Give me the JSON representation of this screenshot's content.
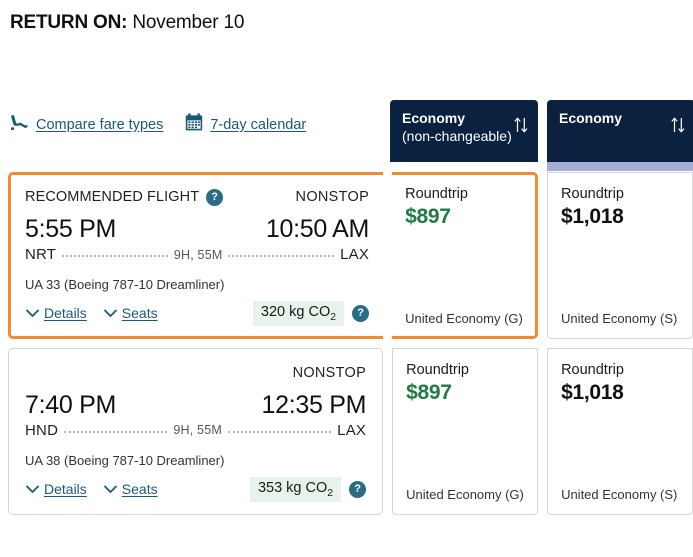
{
  "header": {
    "return_label": "RETURN ON:",
    "return_date": "November 10"
  },
  "toolbar": {
    "links": [
      {
        "icon": "seat-icon",
        "label": "Compare fare types"
      },
      {
        "icon": "calendar-icon",
        "label": "7-day calendar"
      }
    ]
  },
  "colors": {
    "header_navy": "#0a2240",
    "selected_orange": "#f08B33",
    "accent_lavender": "#a7aed4",
    "link_teal": "#1a5a73",
    "price_green": "#1e7b41",
    "co2_green_bg": "#e6f2ea",
    "help_badge": "#2b6c85"
  },
  "fare_columns": [
    {
      "title": "Economy",
      "subtitle": "(non-changeable)",
      "sort_icon": "sort-arrows-icon",
      "accent": "none"
    },
    {
      "title": "Economy",
      "subtitle": "",
      "sort_icon": "sort-arrows-icon",
      "accent": "lavender"
    }
  ],
  "flights": [
    {
      "selected": true,
      "recommended_label": "RECOMMENDED FLIGHT",
      "help_icon": "?",
      "stops": "NONSTOP",
      "depart_time": "5:55 PM",
      "arrive_time": "10:50 AM",
      "origin": "NRT",
      "destination": "LAX",
      "duration": "9H, 55M",
      "aircraft": "UA 33 (Boeing 787-10 Dreamliner)",
      "details_label": "Details",
      "seats_label": "Seats",
      "co2_value": "320 kg CO",
      "co2_sub": "2",
      "co2_help_icon": "?",
      "fares": [
        {
          "trip_type": "Roundtrip",
          "price": "$897",
          "price_style": "green",
          "fare_class": "United Economy (G)",
          "selected": true
        },
        {
          "trip_type": "Roundtrip",
          "price": "$1,018",
          "price_style": "black",
          "fare_class": "United Economy (S)",
          "selected": false
        }
      ]
    },
    {
      "selected": false,
      "recommended_label": "",
      "help_icon": "",
      "stops": "NONSTOP",
      "depart_time": "7:40 PM",
      "arrive_time": "12:35 PM",
      "origin": "HND",
      "destination": "LAX",
      "duration": "9H, 55M",
      "aircraft": "UA 38 (Boeing 787-10 Dreamliner)",
      "details_label": "Details",
      "seats_label": "Seats",
      "co2_value": "353 kg CO",
      "co2_sub": "2",
      "co2_help_icon": "?",
      "fares": [
        {
          "trip_type": "Roundtrip",
          "price": "$897",
          "price_style": "green",
          "fare_class": "United Economy (G)",
          "selected": false
        },
        {
          "trip_type": "Roundtrip",
          "price": "$1,018",
          "price_style": "black",
          "fare_class": "United Economy (S)",
          "selected": false
        }
      ]
    }
  ]
}
